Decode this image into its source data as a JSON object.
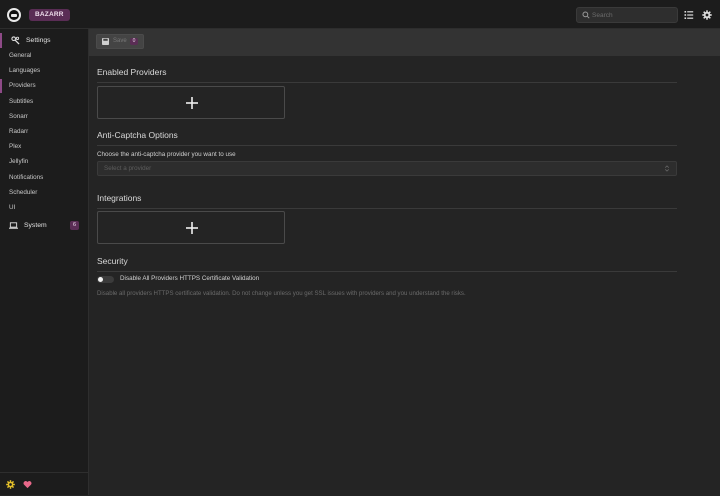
{
  "header": {
    "brand": "BAZARR",
    "search_placeholder": "Search",
    "icons": [
      "logo-icon",
      "search-icon",
      "list-icon",
      "gear-icon"
    ]
  },
  "sidebar": {
    "settings_label": "Settings",
    "items": [
      {
        "label": "General"
      },
      {
        "label": "Languages"
      },
      {
        "label": "Providers"
      },
      {
        "label": "Subtitles"
      },
      {
        "label": "Sonarr"
      },
      {
        "label": "Radarr"
      },
      {
        "label": "Plex"
      },
      {
        "label": "Jellyfin"
      },
      {
        "label": "Notifications"
      },
      {
        "label": "Scheduler"
      },
      {
        "label": "UI"
      }
    ],
    "system_label": "System",
    "system_badge": "6",
    "footer_icons": [
      "sun-gear-icon",
      "heart-icon"
    ]
  },
  "toolbar": {
    "save_label": "Save",
    "save_badge": "0"
  },
  "main": {
    "enabled_providers_title": "Enabled Providers",
    "anticaptcha_title": "Anti-Captcha Options",
    "anticaptcha_label": "Choose the anti-captcha provider you want to use",
    "anticaptcha_placeholder": "Select a provider",
    "integrations_title": "Integrations",
    "security_title": "Security",
    "security_toggle_label": "Disable All Providers HTTPS Certificate Validation",
    "security_toggle_on": false,
    "security_help": "Disable all providers HTTPS certificate validation. Do not change unless you get SSL issues with providers and you understand the risks."
  },
  "colors": {
    "accent": "#8e4a87",
    "brand_bg": "#5a2d55",
    "background": "#242424",
    "sidebar_bg": "#1c1c1c",
    "toolbar_bg": "#333333"
  }
}
